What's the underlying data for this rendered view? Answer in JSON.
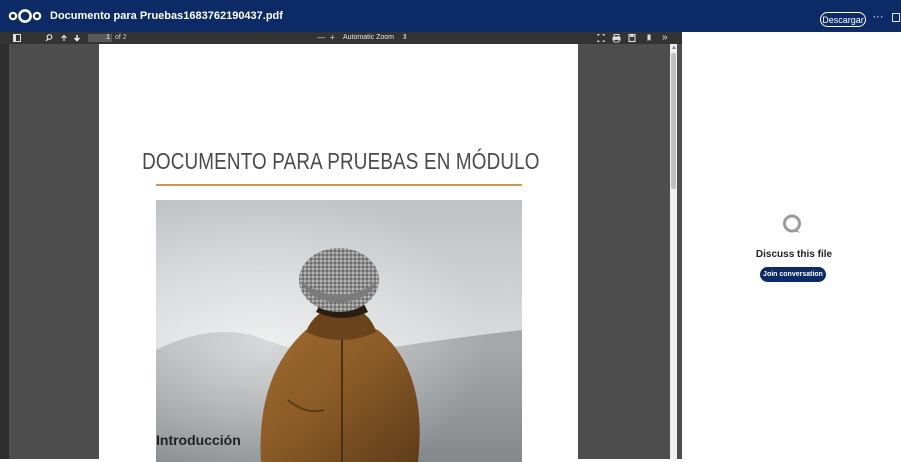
{
  "header": {
    "filename": "Documento para Pruebas1683762190437.pdf",
    "download_label": "Descargar",
    "more_label": "···"
  },
  "pdf_toolbar": {
    "page_number": "1",
    "page_count": "of 2",
    "zoom_out": "—",
    "zoom_in": "+",
    "zoom_value": "Automatic Zoom",
    "zoom_caret": "⇕",
    "tools_label": "»"
  },
  "document": {
    "title": "DOCUMENTO PARA PRUEBAS EN MÓDULO",
    "section_heading": "Introducción"
  },
  "sidebar": {
    "discuss_text": "Discuss this file",
    "join_label": "Join conversation"
  },
  "colors": {
    "header_bg": "#0b2a66",
    "viewer_bg": "#4d4d4d",
    "toolbar_bg": "#333333",
    "accent_rule": "#c49a5a",
    "button_bg": "#0b2a66"
  }
}
